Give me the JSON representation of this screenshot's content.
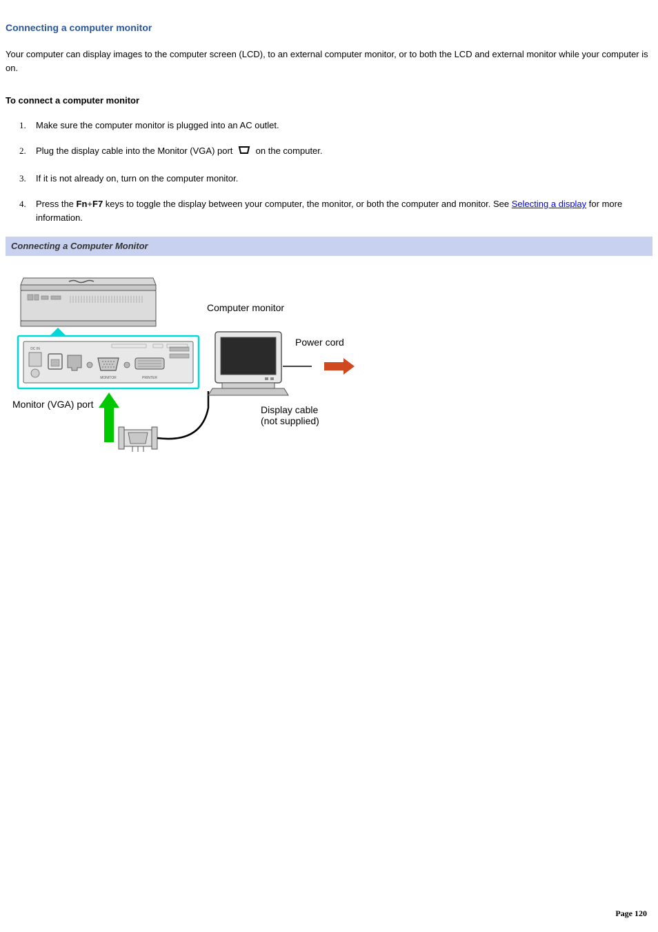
{
  "heading": "Connecting a computer monitor",
  "intro": "Your computer can display images to the computer screen (LCD), to an external computer monitor, or to both the LCD and external monitor while your computer is on.",
  "subheading": "To connect a computer monitor",
  "steps": {
    "s1": "Make sure the computer monitor is plugged into an AC outlet.",
    "s2a": "Plug the display cable into the Monitor (VGA) port ",
    "s2b": " on the computer.",
    "s3": "If it is not already on, turn on the computer monitor.",
    "s4a": "Press the ",
    "s4_fn": "Fn",
    "s4_plus": "+",
    "s4_f7": "F7",
    "s4b": " keys to toggle the display between your computer, the monitor, or both the computer and monitor. See ",
    "s4_link": "Selecting a display",
    "s4c": " for more information."
  },
  "figure_title": "Connecting a Computer Monitor",
  "labels": {
    "computer_monitor": "Computer monitor",
    "power_cord": "Power cord",
    "vga_port": "Monitor (VGA) port",
    "display_cable_1": "Display cable",
    "display_cable_2": "(not supplied)"
  },
  "page_label": "Page 120"
}
